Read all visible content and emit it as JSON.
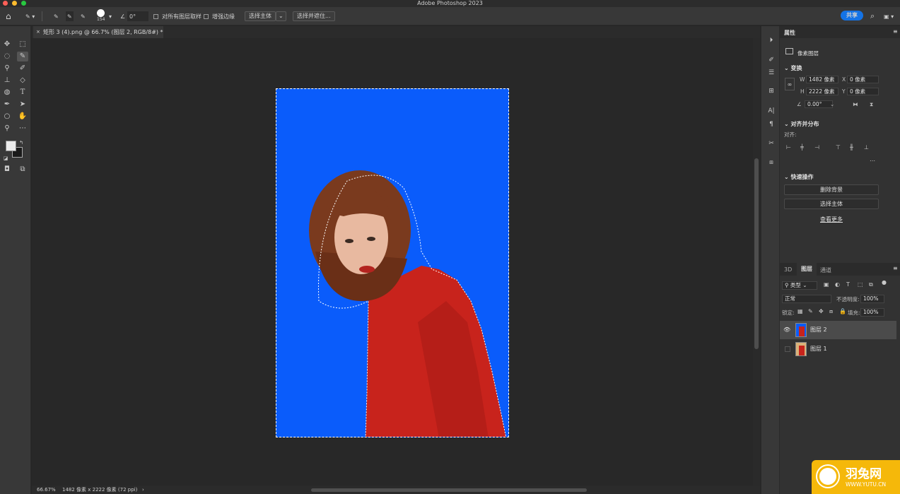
{
  "app": {
    "title": "Adobe Photoshop 2023"
  },
  "options": {
    "brush_size": "154",
    "angle": "0°",
    "sample_all_label": "对所有图层取样",
    "enhance_edge_label": "增强边缘",
    "select_subject": "选择主体",
    "select_mask": "选择并遮住...",
    "share": "共享"
  },
  "document": {
    "tab_title": "矩形 3 (4).png @ 66.7% (图层 2, RGB/8#) *"
  },
  "status": {
    "zoom": "66.67%",
    "dimensions": "1482 像素 x 2222 像素 (72 ppi)"
  },
  "properties": {
    "tab": "属性",
    "type": "像素图层",
    "transform": "变换",
    "w_label": "W",
    "w": "1482 像素",
    "x_label": "X",
    "x": "0 像素",
    "h_label": "H",
    "h": "2222 像素",
    "y_label": "Y",
    "y": "0 像素",
    "angle": "0.00°",
    "align_section": "对齐并分布",
    "align_label": "对齐:",
    "quick_actions": "快速操作",
    "remove_bg": "删除背景",
    "select_subject": "选择主体",
    "more": "查看更多"
  },
  "layers_panel": {
    "tabs": [
      "3D",
      "图层",
      "通道"
    ],
    "filter": "类型",
    "blend": "正常",
    "opacity_label": "不透明度:",
    "opacity": "100%",
    "lock_label": "锁定:",
    "fill_label": "填充:",
    "fill": "100%",
    "layers": [
      {
        "name": "图层 2"
      },
      {
        "name": "图层 1"
      }
    ]
  },
  "watermark": {
    "brand": "羽兔网",
    "url": "WWW.YUTU.CN"
  },
  "colors": {
    "canvas_bg": "#0a5cfb",
    "accent": "#1473e6",
    "sweater": "#c8231c",
    "hair": "#7a3a1e"
  }
}
